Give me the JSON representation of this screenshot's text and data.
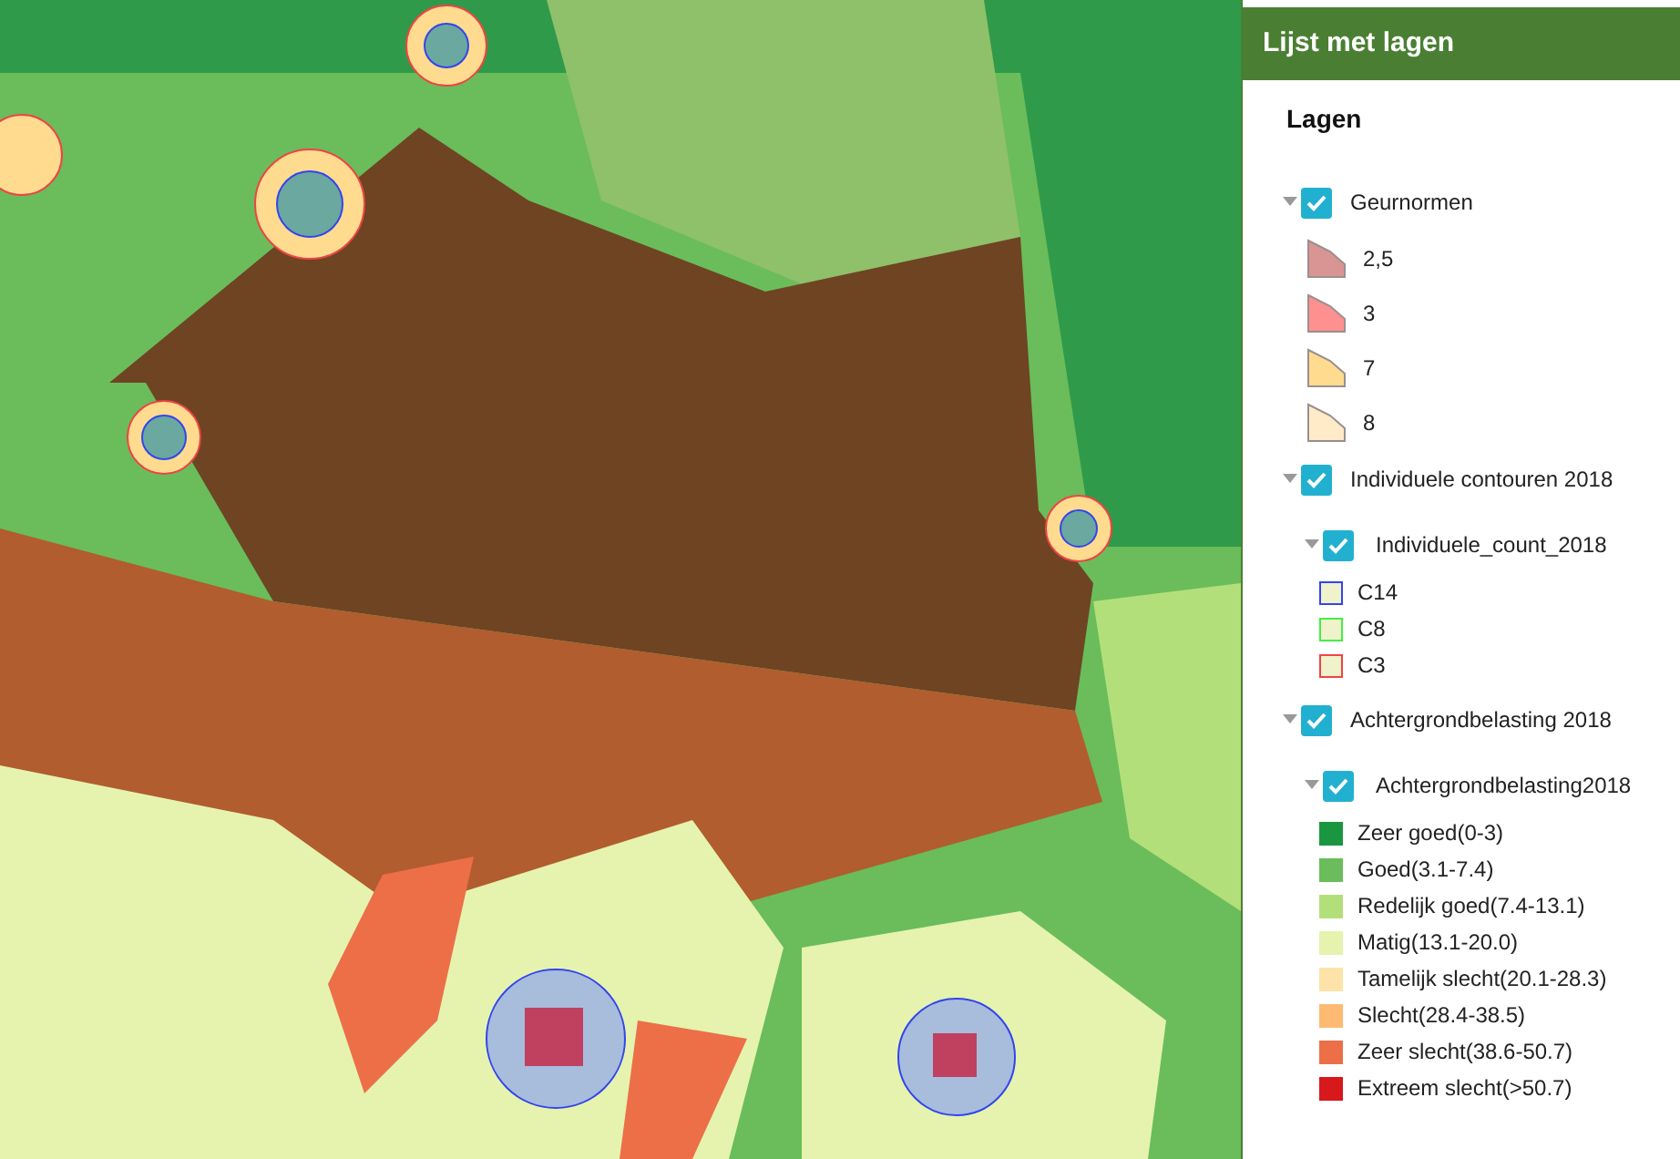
{
  "panel": {
    "title": "Lijst met lagen",
    "heading": "Lagen",
    "layers": [
      {
        "name": "Geurnormen",
        "checked": true,
        "expanded": true,
        "legend": [
          {
            "label": "2,5",
            "kind": "polygon",
            "color": "#d99594"
          },
          {
            "label": "3",
            "kind": "polygon",
            "color": "#ff9090"
          },
          {
            "label": "7",
            "kind": "polygon",
            "color": "#ffdb8f"
          },
          {
            "label": "8",
            "kind": "polygon",
            "color": "#ffebc8"
          }
        ]
      },
      {
        "name": "Individuele contouren 2018",
        "checked": true,
        "expanded": true,
        "children": [
          {
            "name": "Individuele_count_2018",
            "checked": true,
            "expanded": true,
            "legend": [
              {
                "label": "C14",
                "kind": "outline",
                "color": "#3344ee"
              },
              {
                "label": "C8",
                "kind": "outline",
                "color": "#44ee44"
              },
              {
                "label": "C3",
                "kind": "outline",
                "color": "#ee4444"
              }
            ]
          }
        ]
      },
      {
        "name": "Achtergrondbelasting 2018",
        "checked": true,
        "expanded": true,
        "children": [
          {
            "name": "Achtergrondbelasting2018",
            "checked": true,
            "expanded": true,
            "legend": [
              {
                "label": "Zeer goed(0-3)",
                "kind": "swatch",
                "color": "#1a9641"
              },
              {
                "label": "Goed(3.1-7.4)",
                "kind": "swatch",
                "color": "#6abd5a"
              },
              {
                "label": "Redelijk goed(7.4-13.1)",
                "kind": "swatch",
                "color": "#b3df7a"
              },
              {
                "label": "Matig(13.1-20.0)",
                "kind": "swatch",
                "color": "#e5f3ae"
              },
              {
                "label": "Tamelijk slecht(20.1-28.3)",
                "kind": "swatch",
                "color": "#fee3a8"
              },
              {
                "label": "Slecht(28.4-38.5)",
                "kind": "swatch",
                "color": "#fdba72"
              },
              {
                "label": "Zeer slecht(38.6-50.7)",
                "kind": "swatch",
                "color": "#ec6f48"
              },
              {
                "label": "Extreem slecht(>50.7)",
                "kind": "swatch",
                "color": "#d7191c"
              }
            ]
          }
        ]
      }
    ]
  }
}
